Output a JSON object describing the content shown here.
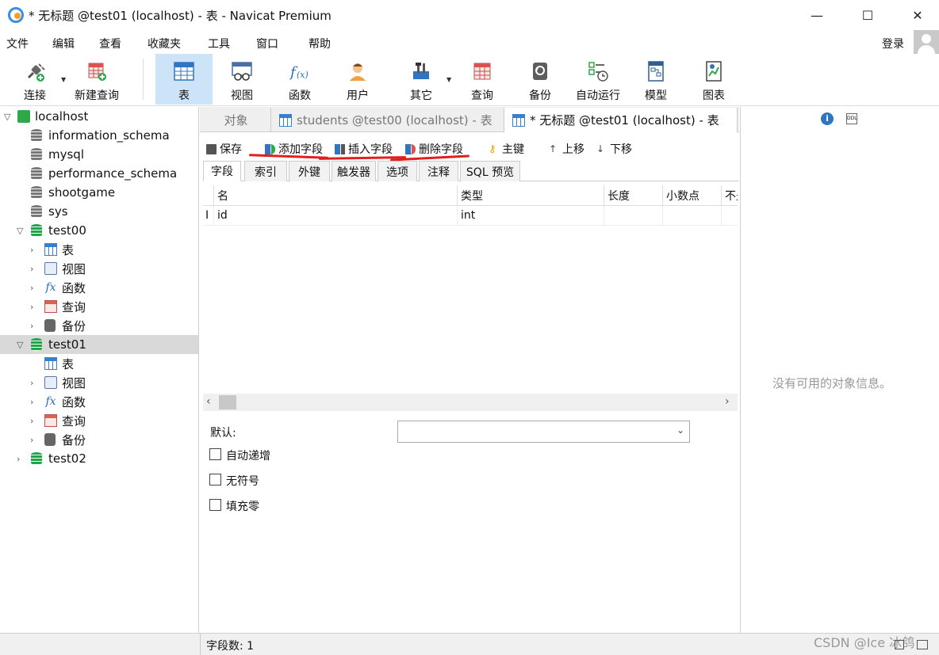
{
  "window": {
    "title": "* 无标题 @test01 (localhost) - 表 - Navicat Premium",
    "minimize": "—",
    "maximize": "☐",
    "close": "✕"
  },
  "menu": {
    "items": [
      "文件",
      "编辑",
      "查看",
      "收藏夹",
      "工具",
      "窗口",
      "帮助"
    ],
    "login": "登录"
  },
  "toolbar": {
    "items": [
      "连接",
      "新建查询",
      "表",
      "视图",
      "函数",
      "用户",
      "其它",
      "查询",
      "备份",
      "自动运行",
      "模型",
      "图表"
    ],
    "active": "表"
  },
  "tree": {
    "connection": "localhost",
    "databases": [
      "information_schema",
      "mysql",
      "performance_schema",
      "shootgame",
      "sys"
    ],
    "test00": {
      "name": "test00",
      "children": [
        "表",
        "视图",
        "函数",
        "查询",
        "备份"
      ]
    },
    "test01": {
      "name": "test01",
      "children": [
        "表",
        "视图",
        "函数",
        "查询",
        "备份"
      ]
    },
    "test02": {
      "name": "test02"
    },
    "selected": "test01"
  },
  "tabs": [
    "对象",
    "students @test00 (localhost) - 表",
    "* 无标题 @test01 (localhost) - 表"
  ],
  "actions": {
    "save": "保存",
    "add_field": "添加字段",
    "insert_field": "插入字段",
    "delete_field": "删除字段",
    "primary_key": "主键",
    "move_up": "上移",
    "move_down": "下移"
  },
  "subtabs": [
    "字段",
    "索引",
    "外键",
    "触发器",
    "选项",
    "注释",
    "SQL 预览"
  ],
  "grid": {
    "headers": [
      "名",
      "类型",
      "长度",
      "小数点",
      "不是 null"
    ],
    "rows": [
      {
        "marker": "I",
        "name": "id",
        "type": "int",
        "length": "",
        "decimals": ""
      }
    ]
  },
  "props": {
    "default_label": "默认:",
    "default_value": "",
    "auto_increment": "自动递增",
    "unsigned": "无符号",
    "zerofill": "填充零"
  },
  "right_panel": {
    "empty_text": "没有可用的对象信息。"
  },
  "status": {
    "field_count": "字段数: 1"
  },
  "watermark": "CSDN @Ice 冰鸽"
}
